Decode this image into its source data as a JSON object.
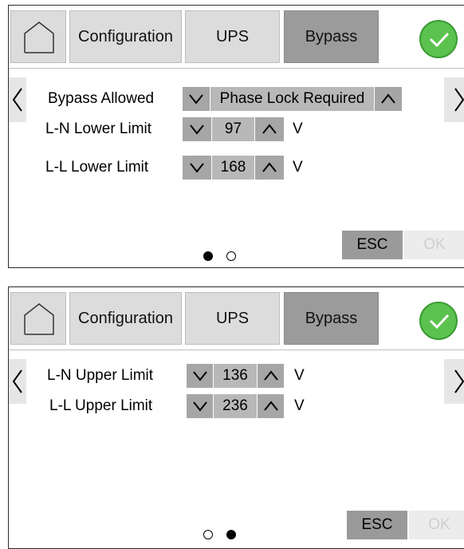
{
  "panels": [
    {
      "tabs": {
        "configuration": "Configuration",
        "ups": "UPS",
        "bypass": "Bypass",
        "selected": "Bypass"
      },
      "rows": [
        {
          "label": "Bypass Allowed",
          "value": "Phase Lock Required"
        },
        {
          "label": "L-N Lower Limit",
          "value": "97",
          "unit": "V"
        },
        {
          "label": "L-L Lower Limit",
          "value": "168",
          "unit": "V"
        }
      ],
      "pagination": {
        "current_page": 1,
        "total_pages": 2
      },
      "buttons": {
        "esc": "ESC",
        "ok": "OK"
      }
    },
    {
      "tabs": {
        "configuration": "Configuration",
        "ups": "UPS",
        "bypass": "Bypass",
        "selected": "Bypass"
      },
      "rows": [
        {
          "label": "L-N Upper Limit",
          "value": "136",
          "unit": "V"
        },
        {
          "label": "L-L Upper Limit",
          "value": "236",
          "unit": "V"
        }
      ],
      "pagination": {
        "current_page": 2,
        "total_pages": 2
      },
      "buttons": {
        "esc": "ESC",
        "ok": "OK"
      }
    }
  ],
  "icons": {
    "home": "home-icon",
    "confirm": "checkmark-icon",
    "prev": "chevron-left-icon",
    "next": "chevron-right-icon",
    "decrease": "chevron-down-icon",
    "increase": "chevron-up-icon"
  },
  "colors": {
    "confirm_green": "#5cc24f",
    "selected_tab": "#9b9b9b",
    "tab": "#dcdcdc",
    "stepper": "#a6a6a6",
    "esc_button": "#9a9a9a",
    "ok_disabled": "#ececec"
  }
}
